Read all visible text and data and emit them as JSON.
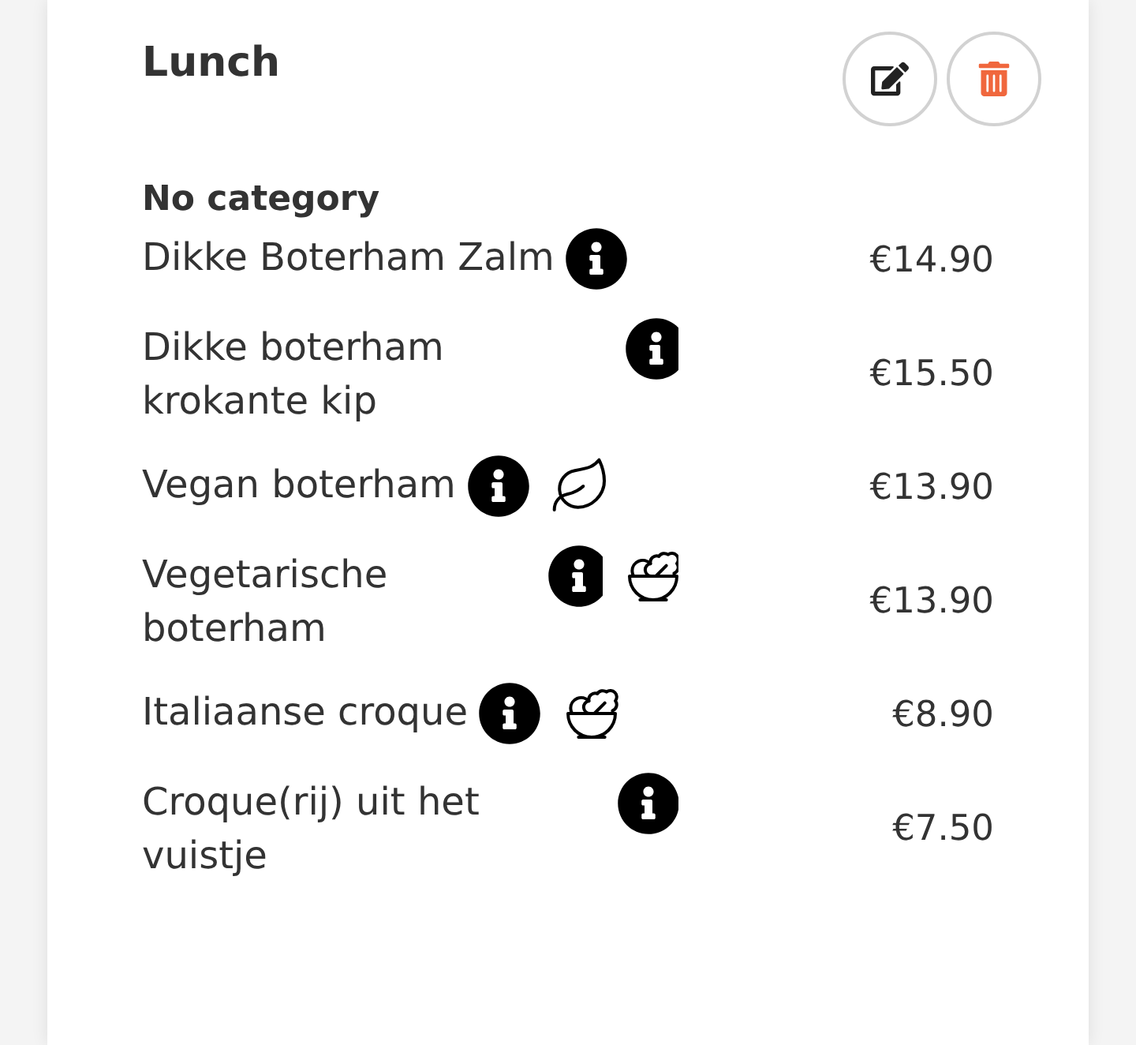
{
  "section": {
    "title": "Lunch"
  },
  "category": {
    "title": "No category"
  },
  "items": [
    {
      "name": "Dikke Boterham Zalm",
      "price": "€14.90",
      "info": true
    },
    {
      "name": "Dikke boterham krokante kip",
      "price": "€15.50",
      "info": true
    },
    {
      "name": "Vegan boterham",
      "price": "€13.90",
      "info": true,
      "diet": {
        "kind": "vegan"
      }
    },
    {
      "name": "Vegetarische boterham",
      "price": "€13.90",
      "info": true,
      "diet": {
        "kind": "vegetarian"
      }
    },
    {
      "name": "Italiaanse croque",
      "price": "€8.90",
      "info": true,
      "diet": {
        "kind": "vegetarian"
      }
    },
    {
      "name": "Croque(rij) uit het vuistje",
      "price": "€7.50",
      "info": true
    }
  ]
}
